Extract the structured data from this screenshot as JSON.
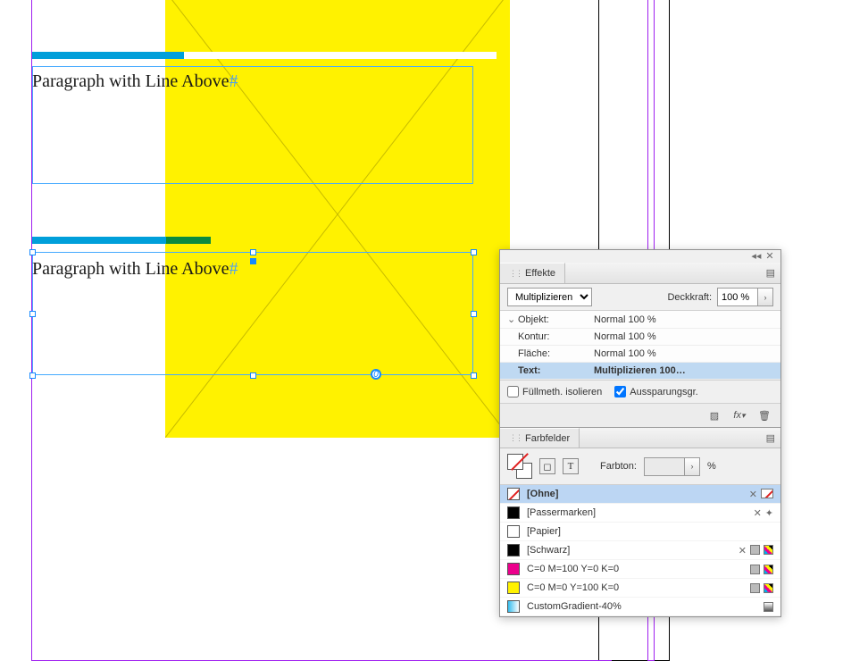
{
  "docText1": "Paragraph with Line Above",
  "docText2": "Paragraph with Line Above",
  "hashChar": "#",
  "effects": {
    "panelTitle": "Effekte",
    "blendModeSelected": "Multiplizieren",
    "opacityLabel": "Deckkraft:",
    "opacityValue": "100 %",
    "targets": {
      "object": {
        "label": "Objekt:",
        "value": "Normal 100 %"
      },
      "stroke": {
        "label": "Kontur:",
        "value": "Normal 100 %"
      },
      "fill": {
        "label": "Fläche:",
        "value": "Normal 100 %"
      },
      "text": {
        "label": "Text:",
        "value": "Multiplizieren 100…"
      }
    },
    "isolateLabel": "Füllmeth. isolieren",
    "knockoutLabel": "Aussparungsgr."
  },
  "swatches": {
    "panelTitle": "Farbfelder",
    "tintLabel": "Farbton:",
    "tintValue": "",
    "tintUnit": "%",
    "items": [
      {
        "name": "[Ohne]",
        "color": null,
        "noneIcon": true,
        "system": true,
        "lockIcon": true
      },
      {
        "name": "[Passermarken]",
        "color": "#000000",
        "system": true,
        "lockIcon": true,
        "regIcon": true
      },
      {
        "name": "[Papier]",
        "color": "#ffffff"
      },
      {
        "name": "[Schwarz]",
        "color": "#000000",
        "lockIcon": true,
        "cmykIcon": true
      },
      {
        "name": "C=0 M=100 Y=0 K=0",
        "color": "#ec008c",
        "cmykIcon": true
      },
      {
        "name": "C=0 M=0 Y=100 K=0",
        "color": "#fff200",
        "cmykIcon": true
      },
      {
        "name": "CustomGradient-40%",
        "color": "#33bdee",
        "gradIcon": true
      }
    ]
  }
}
